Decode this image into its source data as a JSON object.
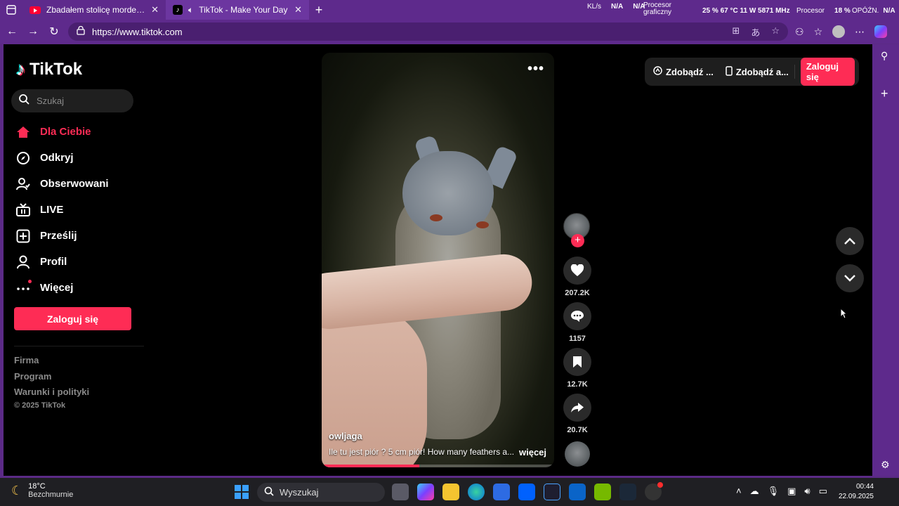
{
  "browser": {
    "tabs": [
      {
        "title": "Zbadałem stolicę morderstw na świecie"
      },
      {
        "title": "TikTok - Make Your Day"
      }
    ],
    "url": "https://www.tiktok.com",
    "hardware": {
      "kbs_label": "KL/s",
      "kbs_value": "N/A",
      "kbs_value2": "N/A",
      "gpu_label": "Procesor graficzny",
      "gpu_stats": "25 %  67 °C  11 W  5871 MHz",
      "cpu_label": "Procesor",
      "cpu_value": "18 %",
      "latency_label": "OPÓŹN.",
      "latency_value": "N/A"
    }
  },
  "tiktok": {
    "logo_text": "TikTok",
    "search_placeholder": "Szukaj",
    "menu": [
      {
        "label": "Dla Ciebie"
      },
      {
        "label": "Odkryj"
      },
      {
        "label": "Obserwowani"
      },
      {
        "label": "LIVE"
      },
      {
        "label": "Prześlij"
      },
      {
        "label": "Profil"
      },
      {
        "label": "Więcej"
      }
    ],
    "login_button": "Zaloguj się",
    "footer": [
      "Firma",
      "Program",
      "Warunki i polityki"
    ],
    "copyright": "© 2025 TikTok",
    "top_pill": {
      "item1": "Zdobądź ...",
      "item2": "Zdobądź a...",
      "login": "Zaloguj się"
    },
    "video": {
      "author": "owljaga",
      "caption": "Ile tu jest piór ? 5 cm piór! How many feathers a...",
      "more": "więcej",
      "progress": 0.42
    },
    "actions": {
      "likes": "207.2K",
      "comments": "1157",
      "saves": "12.7K",
      "shares": "20.7K"
    }
  },
  "taskbar": {
    "temperature": "18°C",
    "weather_desc": "Bezchmurnie",
    "search_placeholder": "Wyszukaj",
    "time": "00:44",
    "date": "22.09.2025"
  },
  "colors": {
    "accent": "#fe2c55",
    "browser_frame": "#5e2a8c"
  }
}
